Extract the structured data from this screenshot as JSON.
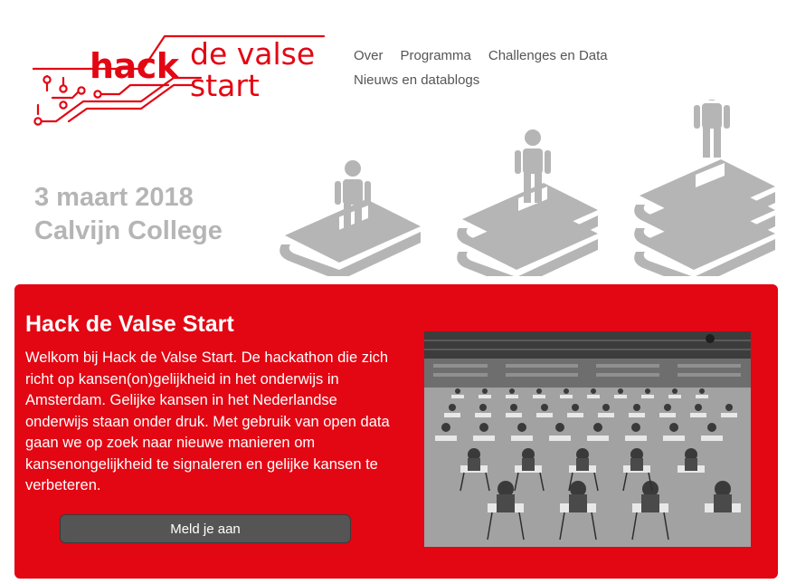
{
  "logo": {
    "hack": "hack",
    "line1": "de valse",
    "line2": "start",
    "color": "#e30613"
  },
  "nav": {
    "items": [
      "Over",
      "Programma",
      "Challenges en Data",
      "Nieuws en datablogs"
    ]
  },
  "event": {
    "date": "3 maart 2018",
    "venue": "Calvijn College"
  },
  "intro": {
    "title": "Hack de Valse Start",
    "body": "Welkom bij Hack de Valse Start. De hackathon die zich richt op kansen(on)gelijkheid in het onderwijs in Amsterdam. Gelijke kansen in het Nederlandse onderwijs staan onder druk. Met gebruik van open data gaan we op zoek naar nieuwe manieren om kansenongelijkheid te signaleren en gelijke kansen te verbeteren.",
    "button": "Meld je aan"
  },
  "colors": {
    "brand": "#e30613",
    "button": "#555555",
    "illustration": "#b5b5b5"
  }
}
